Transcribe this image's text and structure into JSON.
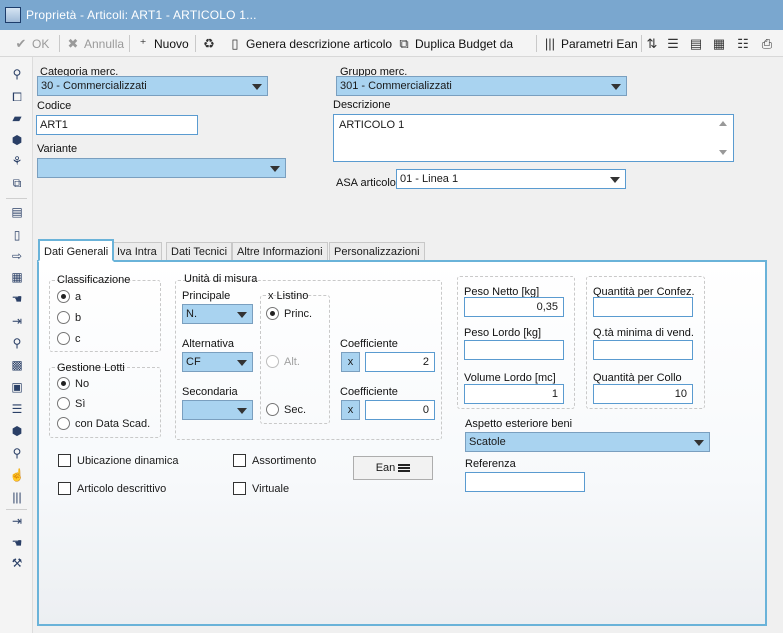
{
  "window": {
    "title": "Proprietà - Articoli: ART1 - ARTICOLO 1..."
  },
  "toolbar": {
    "ok_label": "OK",
    "cancel_label": "Annulla",
    "new_label": "Nuovo",
    "generate_label": "Genera descrizione articolo",
    "duplicate_label": "Duplica Budget da",
    "ean_params_label": "Parametri Ean"
  },
  "header": {
    "categoria_label": "Categoria merc.",
    "categoria_value": "30 - Commercializzati",
    "gruppo_label": "Gruppo merc.",
    "gruppo_value": "301 - Commercializzati",
    "codice_label": "Codice",
    "codice_value": "ART1",
    "descrizione_label": "Descrizione",
    "descrizione_value": "ARTICOLO 1",
    "variante_label": "Variante",
    "variante_value": "",
    "asa_label": "ASA articolo",
    "asa_value": "01 - Linea 1"
  },
  "tabs": [
    {
      "label": "Dati Generali"
    },
    {
      "label": "Iva Intra"
    },
    {
      "label": "Dati Tecnici"
    },
    {
      "label": "Altre Informazioni"
    },
    {
      "label": "Personalizzazioni"
    }
  ],
  "general": {
    "classificazione_title": "Classificazione",
    "class_a": "a",
    "class_b": "b",
    "class_c": "c",
    "lotti_title": "Gestione Lotti",
    "lotti_no": "No",
    "lotti_si": "Sì",
    "lotti_data": "con Data Scad.",
    "um_title": "Unità di misura",
    "principale_label": "Principale",
    "principale_value": "N.",
    "alternativa_label": "Alternativa",
    "alternativa_value": "CF",
    "secondaria_label": "Secondaria",
    "secondaria_value": "",
    "listino_title": "x Listino",
    "listino_princ": "Princ.",
    "listino_alt": "Alt.",
    "listino_sec": "Sec.",
    "coeff1_label": "Coefficiente",
    "coeff1_x": "x",
    "coeff1_value": "2",
    "coeff2_label": "Coefficiente",
    "coeff2_x": "x",
    "coeff2_value": "0",
    "ubicazione_label": "Ubicazione dinamica",
    "assortimento_label": "Assortimento",
    "descrittivo_label": "Articolo descrittivo",
    "virtuale_label": "Virtuale",
    "ean_button": "Ean",
    "peso_netto_label": "Peso Netto [kg]",
    "peso_netto_value": "0,35",
    "peso_lordo_label": "Peso Lordo [kg]",
    "peso_lordo_value": "",
    "volume_label": "Volume Lordo [mc]",
    "volume_value": "1",
    "qta_confez_label": "Quantità per Confez.",
    "qta_confez_value": "",
    "qta_min_label": "Q.tà minima di vend.",
    "qta_min_value": "",
    "qta_collo_label": "Quantità per Collo",
    "qta_collo_value": "10",
    "aspetto_label": "Aspetto esteriore beni",
    "aspetto_value": "Scatole",
    "referenza_label": "Referenza",
    "referenza_value": ""
  },
  "colors": {
    "titlebar": "#7aa7cf",
    "combo_fill": "#a9d3f0",
    "accent_border": "#6ab3d9"
  }
}
